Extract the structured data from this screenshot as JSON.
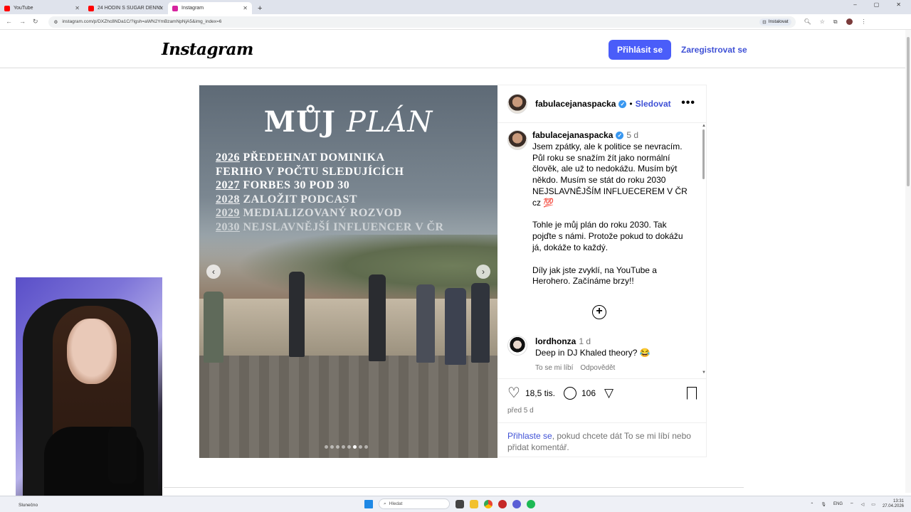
{
  "browser": {
    "tabs": [
      {
        "title": "YouTube",
        "color": "#ff0000"
      },
      {
        "title": "24 HODIN S SUGAR DENNY | #",
        "color": "#ff0000"
      },
      {
        "title": "Instagram",
        "color": "#d6249f"
      }
    ],
    "url": "instagram.com/p/DXZhc8NDa1C/?igsh=aWN2YmBzamNpNjA5&img_index=6",
    "install_label": "Instalovat"
  },
  "header": {
    "logo": "Instagram",
    "login_label": "Přihlásit se",
    "register_label": "Zaregistrovat se"
  },
  "post": {
    "image": {
      "title_a": "MŮJ",
      "title_b": "PLÁN",
      "plan": [
        {
          "year": "2026",
          "text": " PŘEDEHNAT DOMINIKA"
        },
        {
          "year": "",
          "text": "FERIHO V POČTU SLEDUJÍCÍCH"
        },
        {
          "year": "2027",
          "text": " FORBES 30 POD 30"
        },
        {
          "year": "2028",
          "text": " ZALOŽIT PODCAST"
        },
        {
          "year": "2029",
          "text": " MEDIALIZOVANÝ ROZVOD"
        },
        {
          "year": "2030",
          "text": " NEJSLAVNĚJŠÍ INFLUENCER V ČR"
        }
      ],
      "slide_count": 8,
      "active_slide": 6
    },
    "author": "fabulacejanaspacka",
    "follow_label": "Sledovat",
    "caption": {
      "author": "fabulacejanaspacka",
      "ago": "5 d",
      "paragraphs": [
        "Jsem zpátky, ale k politice se nevracím. Půl roku se snažím žít jako normální člověk, ale už to nedokážu. Musím být někdo. Musím se stát do roku 2030 NEJSLAVNĚJŠÍM INFLUECEREM V ČR cz 💯",
        "Tohle je můj plán do roku 2030. Tak pojďte s námi. Protože pokud to dokážu já, dokáže to každý.",
        "Díly jak jste zvyklí, na YouTube a Herohero. Začínáme brzy!!"
      ]
    },
    "comment": {
      "user": "lordhonza",
      "ago": "1 d",
      "text": "Deep in DJ Khaled theory? 😂",
      "like_label": "To se mi líbí",
      "reply_label": "Odpovědět"
    },
    "likes": "18,5 tis.",
    "comments": "106",
    "posted": "před 5 d",
    "login_prompt_link": "Přihlaste se",
    "login_prompt_rest": ", pokud chcete dát To se mi líbí nebo přidat komentář."
  },
  "taskbar": {
    "weather": "Slunečno",
    "search_placeholder": "Hledat",
    "lang": "ENG",
    "time": "13:31",
    "date": "27.04.2026"
  }
}
